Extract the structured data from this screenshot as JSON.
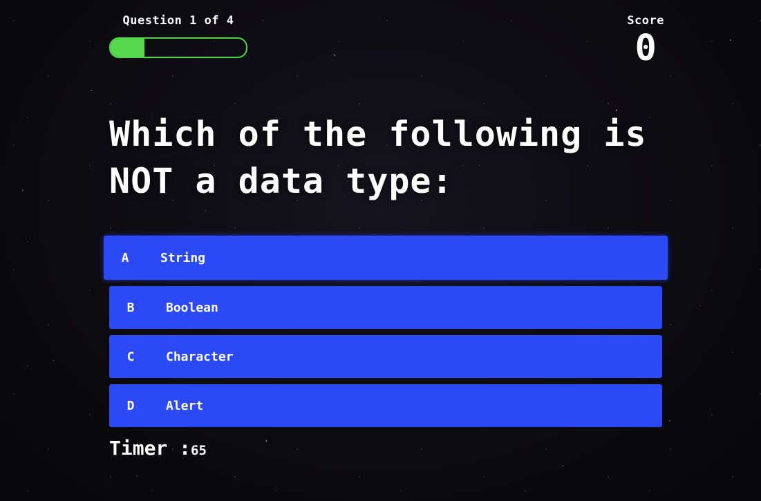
{
  "hud": {
    "question_counter": "Question 1 of 4",
    "progress_fraction": 0.25,
    "score_label": "Score",
    "score_value": "0"
  },
  "question": {
    "text": "Which of the following is NOT a data type:"
  },
  "choices": [
    {
      "prefix": "A",
      "text": "String"
    },
    {
      "prefix": "B",
      "text": "Boolean"
    },
    {
      "prefix": "C",
      "text": "Character"
    },
    {
      "prefix": "D",
      "text": "Alert"
    }
  ],
  "timer": {
    "label": "Timer :",
    "value": "65"
  },
  "colors": {
    "progress_fill": "#56d94c",
    "choice_bg": "#2b49f5"
  }
}
